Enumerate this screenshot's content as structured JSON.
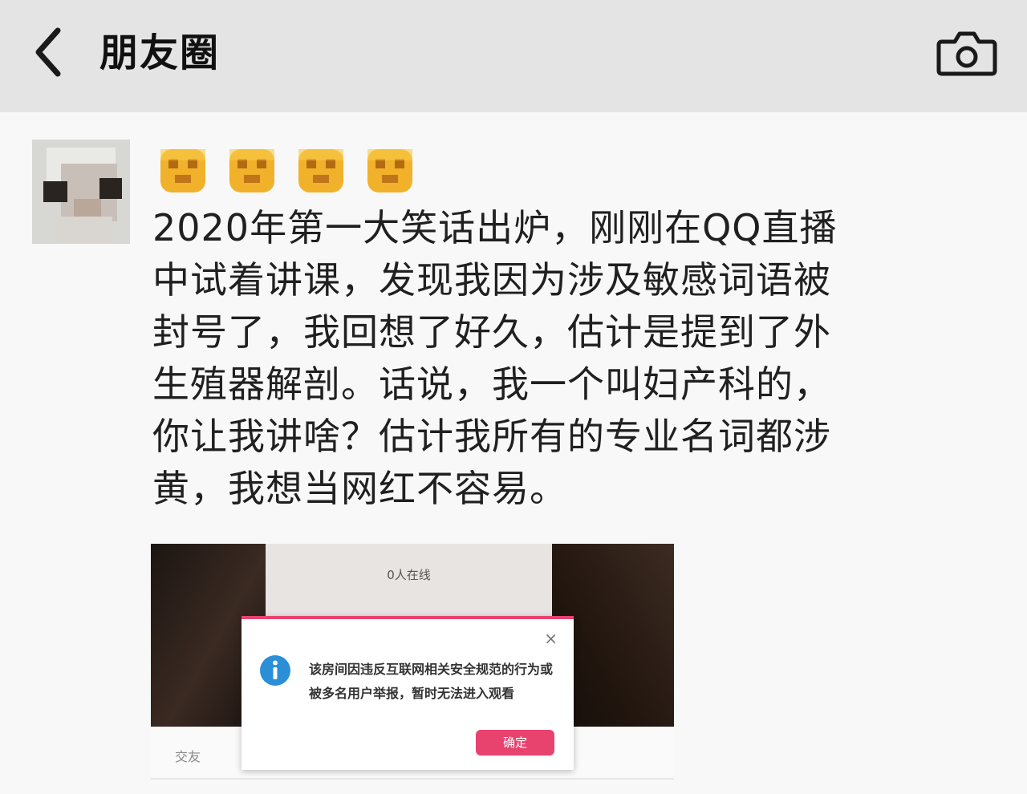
{
  "header": {
    "title": "朋友圈",
    "back_icon": "chevron-left-icon",
    "camera_icon": "camera-icon",
    "background": "#e4e4e4"
  },
  "post": {
    "emoji_icons": [
      "blurred-face-emoji-icon",
      "blurred-face-emoji-icon",
      "blurred-face-emoji-icon",
      "blurred-face-emoji-icon"
    ],
    "text": "2020年第一大笑话出炉，刚刚在QQ直播\n中试着讲课，发现我因为涉及敏感词语被\n封号了，我回想了好久，估计是提到了外\n生殖器解剖。话说，我一个叫妇产科的，\n你让我讲啥？估计我所有的专业名词都涉\n黄，我想当网红不容易。"
  },
  "screenshot": {
    "viewers": "0人在线",
    "strip_label": "交友",
    "dialog": {
      "close": "×",
      "message": "该房间因违反互联网相关安全规范的行为或被多名用户举报，暂时无法进入观看",
      "confirm": "确定",
      "accent": "#e8436f",
      "info_color": "#2a8fd6"
    }
  }
}
